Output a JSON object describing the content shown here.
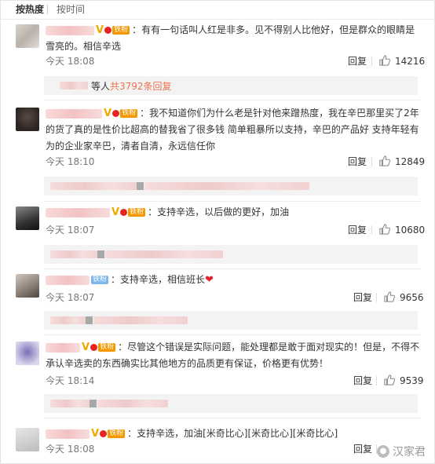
{
  "tabs": {
    "hot": "按热度",
    "time": "按时间"
  },
  "comments": [
    {
      "text": "：有有一句话叫人红是非多。见不得别人比他好，但是群众的眼睛是雪亮的。相信辛选",
      "fan_badge": "铁粉",
      "time": "今天 18:08",
      "reply": "回复",
      "likes": "14216"
    },
    {
      "text": "：我不知道你们为什么老是针对他来蹭热度，我在辛巴那里买了2年的货了真的是性价比超高的替我省了很多钱 简单粗暴所以支持，辛巴的产品好 支持年轻有为的企业家辛巴，清者自清，永远信任你",
      "fan_badge": "铁粉",
      "time": "今天 18:10",
      "reply": "回复",
      "likes": "12849"
    },
    {
      "text": "：支持辛选，以后做的更好，加油",
      "fan_badge": "铁粉",
      "time": "今天 18:07",
      "reply": "回复",
      "likes": "10680"
    },
    {
      "text": "：支持辛选，相信班长",
      "fan_badge": "铁粉",
      "time": "今天 18:07",
      "reply": "回复",
      "likes": "9656"
    },
    {
      "text": "：尽管这个错误是实际问题，能处理都是敢于面对现实的！但是，不得不承认辛选卖的东西确实比其他地方的品质更有保证，价格更有优势！",
      "fan_badge": "铁粉",
      "time": "今天 18:14",
      "reply": "回复",
      "likes": "9539"
    },
    {
      "text": "：支持辛选，加油[米奇比心][米奇比心][米奇比心]",
      "fan_badge": "铁粉",
      "time": "今天 18:08",
      "reply": "回复",
      "likes": ""
    }
  ],
  "sub_reply_summary": {
    "prefix": "等人",
    "total": "共3792条回复"
  },
  "watermark": "汉家君",
  "icons": [
    "thumb-up-icon",
    "v-badge-icon",
    "heart-icon",
    "wechat-icon"
  ],
  "colors": {
    "accent": "#eb7350",
    "fan_badge": "#f39800",
    "vip_gold": "#f0a800",
    "heart": "#e0242d"
  }
}
